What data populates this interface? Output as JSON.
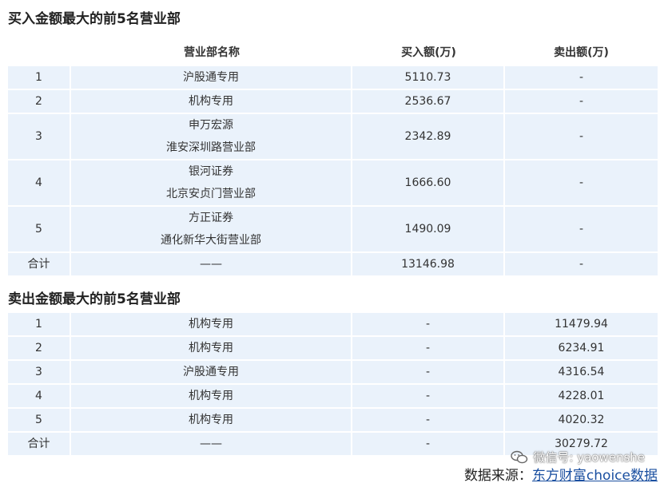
{
  "buy_section": {
    "title": "买入金额最大的前5名营业部",
    "headers": [
      "",
      "营业部名称",
      "买入额(万)",
      "卖出额(万)"
    ],
    "rows": [
      {
        "rank": "1",
        "name_lines": [
          "沪股通专用"
        ],
        "buy": "5110.73",
        "sell": "-"
      },
      {
        "rank": "2",
        "name_lines": [
          "机构专用"
        ],
        "buy": "2536.67",
        "sell": "-"
      },
      {
        "rank": "3",
        "name_lines": [
          "申万宏源",
          "淮安深圳路营业部"
        ],
        "buy": "2342.89",
        "sell": "-"
      },
      {
        "rank": "4",
        "name_lines": [
          "银河证券",
          "北京安贞门营业部"
        ],
        "buy": "1666.60",
        "sell": "-"
      },
      {
        "rank": "5",
        "name_lines": [
          "方正证券",
          "通化新华大街营业部"
        ],
        "buy": "1490.09",
        "sell": "-"
      }
    ],
    "total": {
      "label": "合计",
      "name": "——",
      "buy": "13146.98",
      "sell": "-"
    }
  },
  "sell_section": {
    "title": "卖出金额最大的前5名营业部",
    "rows": [
      {
        "rank": "1",
        "name": "机构专用",
        "buy": "-",
        "sell": "11479.94"
      },
      {
        "rank": "2",
        "name": "机构专用",
        "buy": "-",
        "sell": "6234.91"
      },
      {
        "rank": "3",
        "name": "沪股通专用",
        "buy": "-",
        "sell": "4316.54"
      },
      {
        "rank": "4",
        "name": "机构专用",
        "buy": "-",
        "sell": "4228.01"
      },
      {
        "rank": "5",
        "name": "机构专用",
        "buy": "-",
        "sell": "4020.32"
      }
    ],
    "total": {
      "label": "合计",
      "name": "——",
      "buy": "-",
      "sell": "30279.72"
    }
  },
  "footer": {
    "wechat": "微信号: yaowenshe",
    "source_prefix": "数据来源：",
    "source_link": "东方财富choice数据"
  },
  "colors": {
    "row_bg": "#eaf2fb",
    "link": "#1a4fa0"
  },
  "icons": {
    "wechat": "wechat-icon"
  }
}
